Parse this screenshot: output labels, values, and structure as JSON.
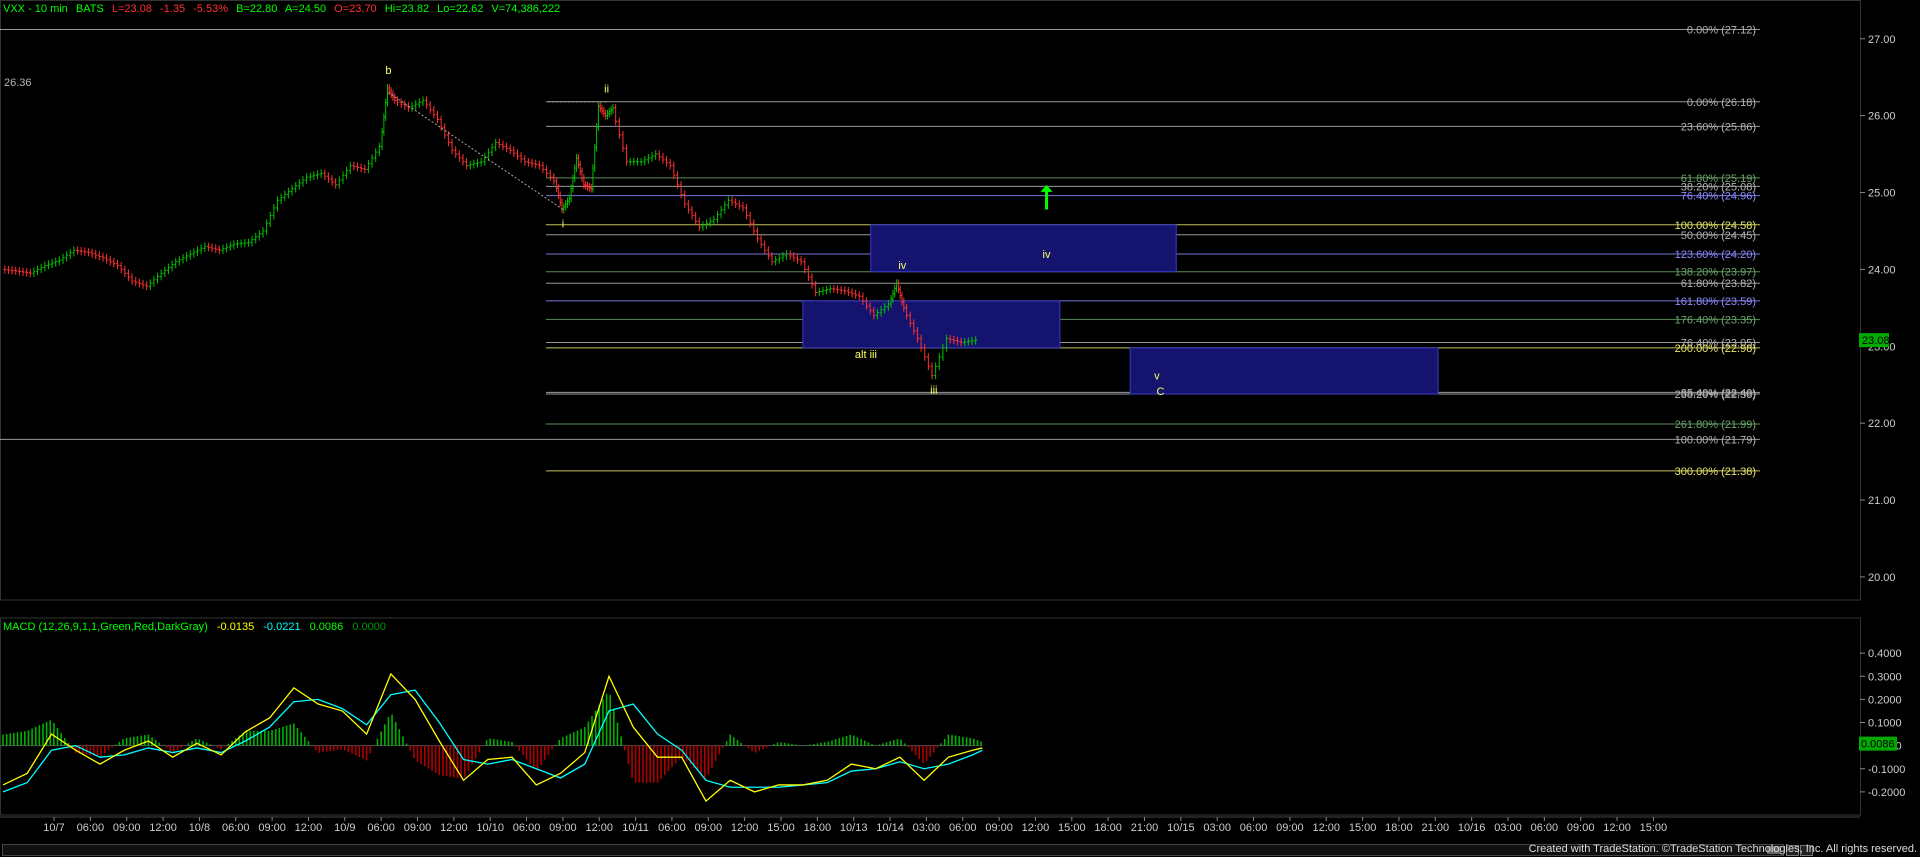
{
  "colors": {
    "background": "#000000",
    "up_bar": "#00c000",
    "down_bar": "#ff3030",
    "macd_pos": "#00b000",
    "macd_neg": "#b00000",
    "macd_line": "#ffff00",
    "signal_line": "#00ffff",
    "wave_label": "#ffff66",
    "fib_gray": "#b4b4b4",
    "fib_green": "#6aa66a",
    "fib_blue": "#8c8cff",
    "fib_yellow": "#e6e66e",
    "zone_fill": "#14146e",
    "arrow": "#00ff00"
  },
  "price_header": {
    "symbol": "VXX - 10 min",
    "exchange": "BATS",
    "last": "L=23.08",
    "change": "-1.35",
    "change_pct": "-5.53%",
    "bid": "B=22.80",
    "ask": "A=24.50",
    "open": "O=23.70",
    "high": "Hi=23.82",
    "low": "Lo=22.62",
    "volume": "V=74,386,222"
  },
  "macd_header": {
    "label": "MACD (12,26,9,1,1,Green,Red,DarkGray)",
    "macd": "-0.0135",
    "signal": "-0.0221",
    "hist": "0.0086",
    "zero": "0.0000"
  },
  "footer": {
    "credit": "Created with TradeStation. ©TradeStation Technologies, Inc. All rights reserved."
  },
  "chart_data": [
    {
      "type": "candlestick",
      "symbol": "VXX",
      "interval": "10 min",
      "ylim": [
        19.7,
        27.4
      ],
      "y_ticks": [
        "27.00",
        "26.00",
        "25.00",
        "24.00",
        "23.00",
        "22.00",
        "21.00",
        "20.00"
      ],
      "last_price": "23.08",
      "price_label_left": "26.36",
      "x_ticks": [
        "10/7",
        "06:00",
        "09:00",
        "12:00",
        "10/8",
        "06:00",
        "09:00",
        "12:00",
        "10/9",
        "06:00",
        "09:00",
        "12:00",
        "10/10",
        "06:00",
        "09:00",
        "12:00",
        "10/11",
        "06:00",
        "09:00",
        "12:00",
        "15:00",
        "18:00",
        "10/13",
        "10/14",
        "03:00",
        "06:00",
        "09:00",
        "12:00",
        "15:00",
        "18:00",
        "21:00",
        "10/15",
        "03:00",
        "06:00",
        "09:00",
        "12:00",
        "15:00",
        "18:00",
        "21:00",
        "10/16",
        "03:00",
        "06:00",
        "09:00",
        "12:00",
        "15:00"
      ],
      "price_path": [
        [
          0,
          24.0
        ],
        [
          12,
          23.98
        ],
        [
          24,
          23.95
        ],
        [
          36,
          24.05
        ],
        [
          48,
          24.12
        ],
        [
          60,
          24.25
        ],
        [
          72,
          24.22
        ],
        [
          84,
          24.15
        ],
        [
          96,
          24.05
        ],
        [
          108,
          23.85
        ],
        [
          120,
          23.78
        ],
        [
          132,
          23.95
        ],
        [
          144,
          24.1
        ],
        [
          156,
          24.2
        ],
        [
          168,
          24.3
        ],
        [
          180,
          24.25
        ],
        [
          192,
          24.33
        ],
        [
          204,
          24.35
        ],
        [
          216,
          24.5
        ],
        [
          228,
          24.9
        ],
        [
          240,
          25.05
        ],
        [
          252,
          25.2
        ],
        [
          264,
          25.25
        ],
        [
          276,
          25.1
        ],
        [
          288,
          25.35
        ],
        [
          300,
          25.3
        ],
        [
          312,
          25.6
        ],
        [
          318,
          26.36
        ],
        [
          324,
          26.2
        ],
        [
          336,
          26.1
        ],
        [
          348,
          26.2
        ],
        [
          360,
          25.95
        ],
        [
          372,
          25.55
        ],
        [
          384,
          25.35
        ],
        [
          396,
          25.4
        ],
        [
          408,
          25.65
        ],
        [
          420,
          25.55
        ],
        [
          432,
          25.4
        ],
        [
          444,
          25.35
        ],
        [
          456,
          25.15
        ],
        [
          462,
          24.78
        ],
        [
          468,
          24.92
        ],
        [
          474,
          25.45
        ],
        [
          480,
          25.1
        ],
        [
          486,
          25.05
        ],
        [
          492,
          26.12
        ],
        [
          498,
          26.0
        ],
        [
          504,
          26.1
        ],
        [
          516,
          25.4
        ],
        [
          528,
          25.4
        ],
        [
          540,
          25.5
        ],
        [
          552,
          25.35
        ],
        [
          564,
          24.85
        ],
        [
          576,
          24.55
        ],
        [
          588,
          24.65
        ],
        [
          600,
          24.9
        ],
        [
          612,
          24.8
        ],
        [
          624,
          24.4
        ],
        [
          636,
          24.1
        ],
        [
          648,
          24.2
        ],
        [
          660,
          24.1
        ],
        [
          672,
          23.7
        ],
        [
          684,
          23.75
        ],
        [
          696,
          23.72
        ],
        [
          708,
          23.65
        ],
        [
          720,
          23.4
        ],
        [
          732,
          23.55
        ],
        [
          738,
          23.82
        ],
        [
          744,
          23.5
        ],
        [
          756,
          23.1
        ],
        [
          768,
          22.62
        ],
        [
          780,
          23.1
        ],
        [
          792,
          23.05
        ],
        [
          804,
          23.08
        ]
      ],
      "fib_levels": [
        {
          "label": "0.00% (27.12)",
          "value": 27.12,
          "color": "gray"
        },
        {
          "label": "0.00% (26.18)",
          "value": 26.18,
          "color": "gray"
        },
        {
          "label": "23.60% (25.86)",
          "value": 25.86,
          "color": "gray"
        },
        {
          "label": "61.80% (25.19)",
          "value": 25.19,
          "color": "green"
        },
        {
          "label": "38.20% (25.08)",
          "value": 25.08,
          "color": "gray"
        },
        {
          "label": "76.40% (24.96)",
          "value": 24.96,
          "color": "blue"
        },
        {
          "label": "100.00% (24.58)",
          "value": 24.58,
          "color": "yellow"
        },
        {
          "label": "50.00% (24.45)",
          "value": 24.45,
          "color": "gray"
        },
        {
          "label": "123.60% (24.20)",
          "value": 24.2,
          "color": "blue"
        },
        {
          "label": "138.20% (23.97)",
          "value": 23.97,
          "color": "green"
        },
        {
          "label": "61.80% (23.82)",
          "value": 23.82,
          "color": "gray"
        },
        {
          "label": "161.80% (23.59)",
          "value": 23.59,
          "color": "blue"
        },
        {
          "label": "176.40% (23.35)",
          "value": 23.35,
          "color": "green"
        },
        {
          "label": "76.40% (23.05)",
          "value": 23.05,
          "color": "gray"
        },
        {
          "label": "200.00% (22.98)",
          "value": 22.98,
          "color": "yellow"
        },
        {
          "label": "85.40% (22.40)",
          "value": 22.4,
          "color": "gray"
        },
        {
          "label": "238.20% (22.38)",
          "value": 22.38,
          "color": "gray"
        },
        {
          "label": "261.80% (21.99)",
          "value": 21.99,
          "color": "green"
        },
        {
          "label": "100.00% (21.79)",
          "value": 21.79,
          "color": "gray"
        },
        {
          "label": "300.00% (21.38)",
          "value": 21.38,
          "color": "yellow"
        }
      ],
      "wave_labels": [
        {
          "text": "b",
          "x": 318,
          "y": 26.36,
          "pos": "above"
        },
        {
          "text": "i",
          "x": 462,
          "y": 24.78,
          "pos": "below"
        },
        {
          "text": "ii",
          "x": 498,
          "y": 26.12,
          "pos": "above"
        },
        {
          "text": "alt iii",
          "x": 712,
          "y": 22.9,
          "pos": "center"
        },
        {
          "text": "iv",
          "x": 742,
          "y": 23.82,
          "pos": "above"
        },
        {
          "text": "iii",
          "x": 768,
          "y": 22.62,
          "pos": "below"
        },
        {
          "text": "iv",
          "x": 861,
          "y": 24.2,
          "pos": "center"
        },
        {
          "text": "v",
          "x": 952,
          "y": 22.62,
          "pos": "center"
        },
        {
          "text": "C",
          "x": 955,
          "y": 22.42,
          "pos": "center"
        }
      ],
      "target_zones": [
        {
          "name": "iv-zone",
          "x0": 716,
          "x1": 968,
          "top": 24.58,
          "bottom": 23.97
        },
        {
          "name": "alt-iii-zone",
          "x0": 660,
          "x1": 872,
          "top": 23.59,
          "bottom": 22.98
        },
        {
          "name": "c-zone",
          "x0": 930,
          "x1": 1184,
          "top": 22.98,
          "bottom": 22.38
        }
      ],
      "up_arrow": {
        "x": 861,
        "top": 25.1,
        "bottom": 24.78
      }
    },
    {
      "type": "macd",
      "params": "12,26,9,1,1",
      "ylim": [
        -0.3,
        0.5
      ],
      "y_ticks": [
        "0.4000",
        "0.3000",
        "0.2000",
        "0.1000",
        "0.0000",
        "-0.1000",
        "-0.2000"
      ],
      "last_value": "0.0086",
      "macd_line": [
        [
          0,
          -0.17
        ],
        [
          20,
          -0.12
        ],
        [
          40,
          0.05
        ],
        [
          60,
          -0.02
        ],
        [
          80,
          -0.08
        ],
        [
          100,
          -0.02
        ],
        [
          120,
          0.02
        ],
        [
          140,
          -0.05
        ],
        [
          160,
          0.01
        ],
        [
          180,
          -0.04
        ],
        [
          200,
          0.06
        ],
        [
          220,
          0.12
        ],
        [
          240,
          0.25
        ],
        [
          260,
          0.18
        ],
        [
          280,
          0.15
        ],
        [
          300,
          0.05
        ],
        [
          320,
          0.31
        ],
        [
          340,
          0.2
        ],
        [
          360,
          0.02
        ],
        [
          380,
          -0.15
        ],
        [
          400,
          -0.06
        ],
        [
          420,
          -0.05
        ],
        [
          440,
          -0.17
        ],
        [
          460,
          -0.12
        ],
        [
          480,
          -0.03
        ],
        [
          500,
          0.3
        ],
        [
          520,
          0.08
        ],
        [
          540,
          -0.05
        ],
        [
          560,
          -0.05
        ],
        [
          580,
          -0.24
        ],
        [
          600,
          -0.15
        ],
        [
          620,
          -0.2
        ],
        [
          640,
          -0.17
        ],
        [
          660,
          -0.17
        ],
        [
          680,
          -0.15
        ],
        [
          700,
          -0.08
        ],
        [
          720,
          -0.1
        ],
        [
          740,
          -0.05
        ],
        [
          760,
          -0.15
        ],
        [
          780,
          -0.05
        ],
        [
          800,
          -0.02
        ],
        [
          808,
          -0.01
        ]
      ],
      "signal_line": [
        [
          0,
          -0.2
        ],
        [
          20,
          -0.16
        ],
        [
          40,
          -0.02
        ],
        [
          60,
          0.0
        ],
        [
          80,
          -0.05
        ],
        [
          100,
          -0.04
        ],
        [
          120,
          -0.01
        ],
        [
          140,
          -0.03
        ],
        [
          160,
          -0.01
        ],
        [
          180,
          -0.03
        ],
        [
          200,
          0.02
        ],
        [
          220,
          0.08
        ],
        [
          240,
          0.19
        ],
        [
          260,
          0.2
        ],
        [
          280,
          0.16
        ],
        [
          300,
          0.09
        ],
        [
          320,
          0.22
        ],
        [
          340,
          0.24
        ],
        [
          360,
          0.1
        ],
        [
          380,
          -0.06
        ],
        [
          400,
          -0.08
        ],
        [
          420,
          -0.06
        ],
        [
          440,
          -0.1
        ],
        [
          460,
          -0.14
        ],
        [
          480,
          -0.08
        ],
        [
          500,
          0.15
        ],
        [
          520,
          0.18
        ],
        [
          540,
          0.05
        ],
        [
          560,
          -0.02
        ],
        [
          580,
          -0.15
        ],
        [
          600,
          -0.18
        ],
        [
          620,
          -0.18
        ],
        [
          640,
          -0.18
        ],
        [
          660,
          -0.17
        ],
        [
          680,
          -0.16
        ],
        [
          700,
          -0.11
        ],
        [
          720,
          -0.1
        ],
        [
          740,
          -0.07
        ],
        [
          760,
          -0.1
        ],
        [
          780,
          -0.08
        ],
        [
          800,
          -0.04
        ],
        [
          808,
          -0.02
        ]
      ]
    }
  ]
}
